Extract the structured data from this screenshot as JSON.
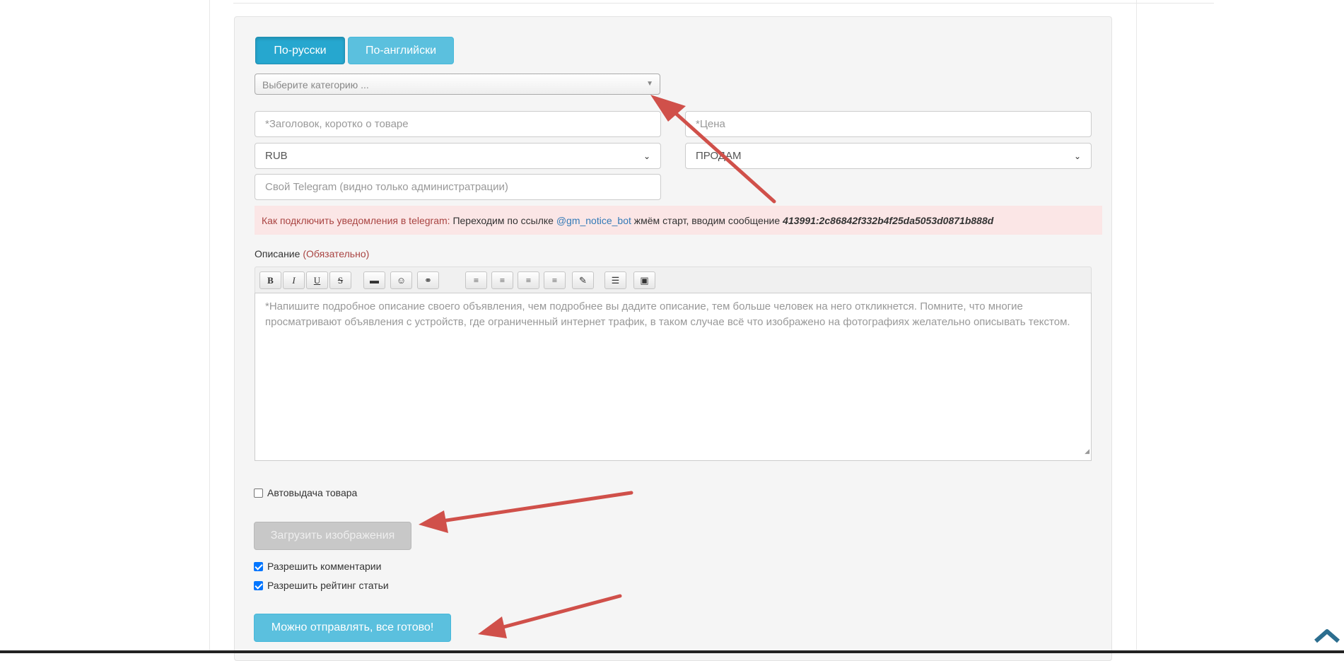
{
  "lang_tabs": {
    "ru": "По-русски",
    "en": "По-английски"
  },
  "category_select": {
    "placeholder": "Выберите категорию ..."
  },
  "fields": {
    "title_placeholder": "*Заголовок, коротко о товаре",
    "price_placeholder": "*Цена",
    "currency_value": "RUB",
    "deal_type_value": "ПРОДАМ",
    "telegram_placeholder": "Свой Telegram (видно только администратрации)"
  },
  "telegram_alert": {
    "label": "Как подключить уведомления в telegram:",
    "text1": "Переходим по ссылке",
    "bot": "@gm_notice_bot",
    "text2": "жмём старт, вводим сообщение",
    "code": "413991:2c86842f332b4f25da5053d0871b888d"
  },
  "description": {
    "label": "Описание",
    "required": "(Обязательно)",
    "placeholder": "*Напишите подробное описание своего объявления, чем подробнее вы дадите описание, тем больше человек на него откликнется. Помните, что многие просматривают объявления с устройств, где ограниченный интернет трафик, в таком случае всё что изображено на фотографиях желательно описывать текстом."
  },
  "toolbar": {
    "bold": "B",
    "italic": "I",
    "underline": "U",
    "strike": "S",
    "folder": "▬",
    "emoji": "☺",
    "link": "⚭",
    "align_left": "≡",
    "align_center": "≡",
    "align_right": "≡",
    "justify": "≡",
    "brush": "✎",
    "format": "☰",
    "save": "▣"
  },
  "auto_delivery": {
    "label": "Автовыдача товара",
    "checked": false
  },
  "upload_button": "Загрузить изображения",
  "allow_comments": {
    "label": "Разрешить комментарии",
    "checked": true
  },
  "allow_rating": {
    "label": "Разрешить рейтинг статьи",
    "checked": true
  },
  "submit_button": "Можно отправлять, все готово!",
  "colors": {
    "accent": "#5bc0de",
    "accent_active": "#26a7cf",
    "annotation_arrow": "#d0504a"
  }
}
